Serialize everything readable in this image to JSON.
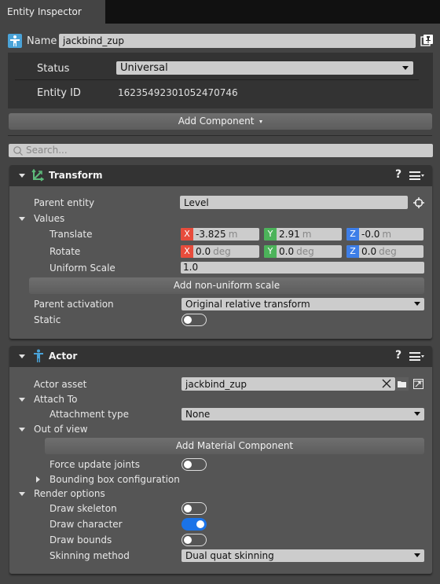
{
  "window": {
    "tab_title": "Entity Inspector"
  },
  "entity": {
    "name_label": "Name",
    "name_value": "jackbind_zup",
    "status_label": "Status",
    "status_value": "Universal",
    "entity_id_label": "Entity ID",
    "entity_id_value": "16235492301052470746"
  },
  "add_component_label": "Add Component",
  "search": {
    "placeholder": "Search..."
  },
  "transform": {
    "title": "Transform",
    "parent_entity_label": "Parent entity",
    "parent_entity_value": "Level",
    "values_label": "Values",
    "translate_label": "Translate",
    "translate": {
      "x": "-3.825",
      "y": "2.91",
      "z": "-0.0",
      "unit": "m"
    },
    "rotate_label": "Rotate",
    "rotate": {
      "x": "0.0",
      "y": "0.0",
      "z": "0.0",
      "unit": "deg"
    },
    "uniform_scale_label": "Uniform Scale",
    "uniform_scale_value": "1.0",
    "add_nonuniform_label": "Add non-uniform scale",
    "parent_activation_label": "Parent activation",
    "parent_activation_value": "Original relative transform",
    "static_label": "Static",
    "static_on": false
  },
  "actor": {
    "title": "Actor",
    "actor_asset_label": "Actor asset",
    "actor_asset_value": "jackbind_zup",
    "attach_to_label": "Attach To",
    "attachment_type_label": "Attachment type",
    "attachment_type_value": "None",
    "out_of_view_label": "Out of view",
    "add_material_label": "Add Material Component",
    "force_update_label": "Force update joints",
    "force_update_on": false,
    "bounding_box_label": "Bounding box configuration",
    "render_options_label": "Render options",
    "draw_skeleton_label": "Draw skeleton",
    "draw_skeleton_on": false,
    "draw_character_label": "Draw character",
    "draw_character_on": true,
    "draw_bounds_label": "Draw bounds",
    "draw_bounds_on": false,
    "skinning_label": "Skinning method",
    "skinning_value": "Dual quat skinning"
  },
  "axis_labels": {
    "x": "X",
    "y": "Y",
    "z": "Z"
  },
  "colors": {
    "x_axis": "#e74c3c",
    "y_axis": "#4cb35a",
    "z_axis": "#3d7ee8",
    "toggle_on": "#1a73e8",
    "transform_icon": "#5dbb7a",
    "actor_icon": "#4aa3d8"
  }
}
